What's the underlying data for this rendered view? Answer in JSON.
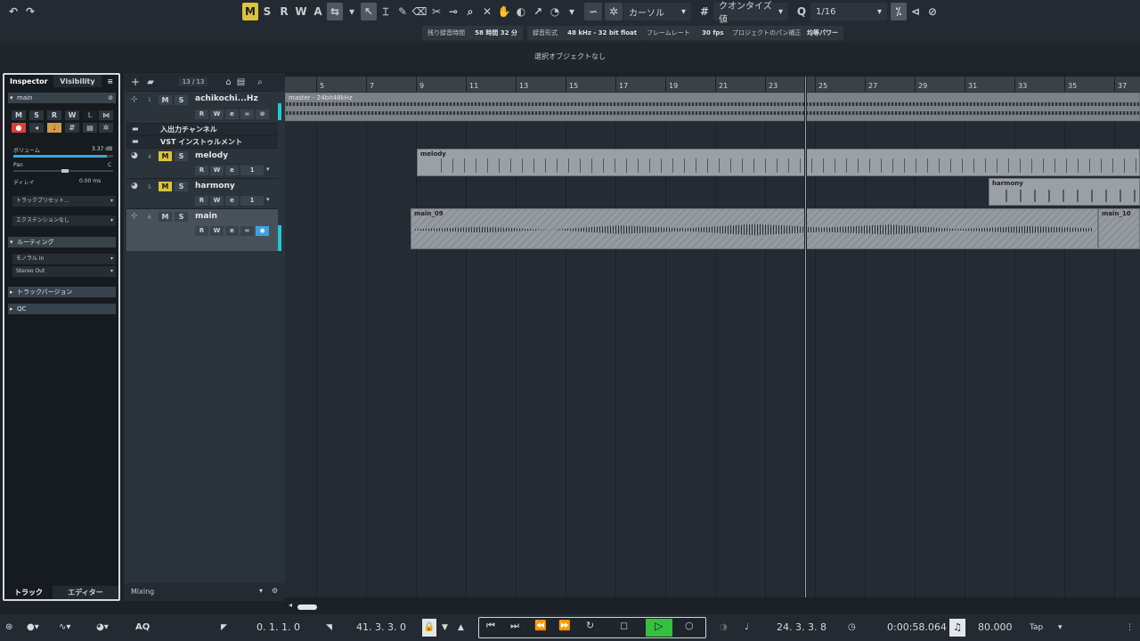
{
  "toolbar": {
    "modes": [
      "M",
      "S",
      "R",
      "W",
      "A"
    ],
    "cursor_mode": "カーソル",
    "quantize_label": "クオンタイズ値",
    "quantize_value": "1/16"
  },
  "status": {
    "rec_time_label": "残り録音時間",
    "rec_time_value": "58 時間 32 分",
    "rec_format_label": "録音形式",
    "rec_format_value": "48 kHz - 32 bit float",
    "frame_rate_label": "フレームレート",
    "frame_rate_value": "30 fps",
    "pan_law_label": "プロジェクトのパン補正",
    "pan_law_value": "均等パワー"
  },
  "info_line": "選択オブジェクトなし",
  "inspector": {
    "tabs": [
      "Inspector",
      "Visibility"
    ],
    "track_name": "main",
    "buttons": [
      "M",
      "S",
      "R",
      "W",
      "L",
      "⋈"
    ],
    "volume_label": "ボリューム",
    "volume_value": "3.37 dB",
    "pan_label": "Pan",
    "pan_value": "C",
    "delay_label": "ディレイ",
    "delay_value": "0.00 ms",
    "track_preset": "トラックプリセット...",
    "extension": "エクステンションなし",
    "routing": "ルーティング",
    "input": "モノラル In",
    "output": "Stereo Out",
    "track_versions": "トラックバージョン",
    "qc": "QC",
    "bottom_tabs": [
      "トラック",
      "エディター"
    ]
  },
  "track_list": {
    "count": "13 / 13",
    "mixing_label": "Mixing",
    "tracks": [
      {
        "num": "1",
        "name": "achikochi...Hz"
      },
      {
        "num": "",
        "name": "入出力チャンネル"
      },
      {
        "num": "",
        "name": "VST インストゥルメント"
      },
      {
        "num": "4",
        "name": "melody"
      },
      {
        "num": "5",
        "name": "harmony"
      },
      {
        "num": "6",
        "name": "main"
      }
    ],
    "rw": [
      "R",
      "W"
    ],
    "channel": "1"
  },
  "ruler": {
    "bars": [
      "5",
      "7",
      "9",
      "11",
      "13",
      "15",
      "17",
      "19",
      "21",
      "23",
      "25",
      "27",
      "29",
      "31",
      "33",
      "35",
      "37"
    ]
  },
  "parts": {
    "master": "master - 24bit48kHz",
    "melody": "melody",
    "harmony": "harmony",
    "main_a": "main_09",
    "main_b": "main_10"
  },
  "transport": {
    "aq": "AQ",
    "left_locator": "0. 1. 1.   0",
    "right_locator": "41. 3. 3.   0",
    "position_bars": "24. 3. 3.   8",
    "position_time": "0:00:58.064",
    "tempo": "80.000",
    "tap": "Tap"
  },
  "colors": {
    "accent": "#dcc33c",
    "play": "#33c13f",
    "record": "#e23b3b",
    "monitor": "#3aa1e6",
    "track_meter": "#21c8d2"
  }
}
